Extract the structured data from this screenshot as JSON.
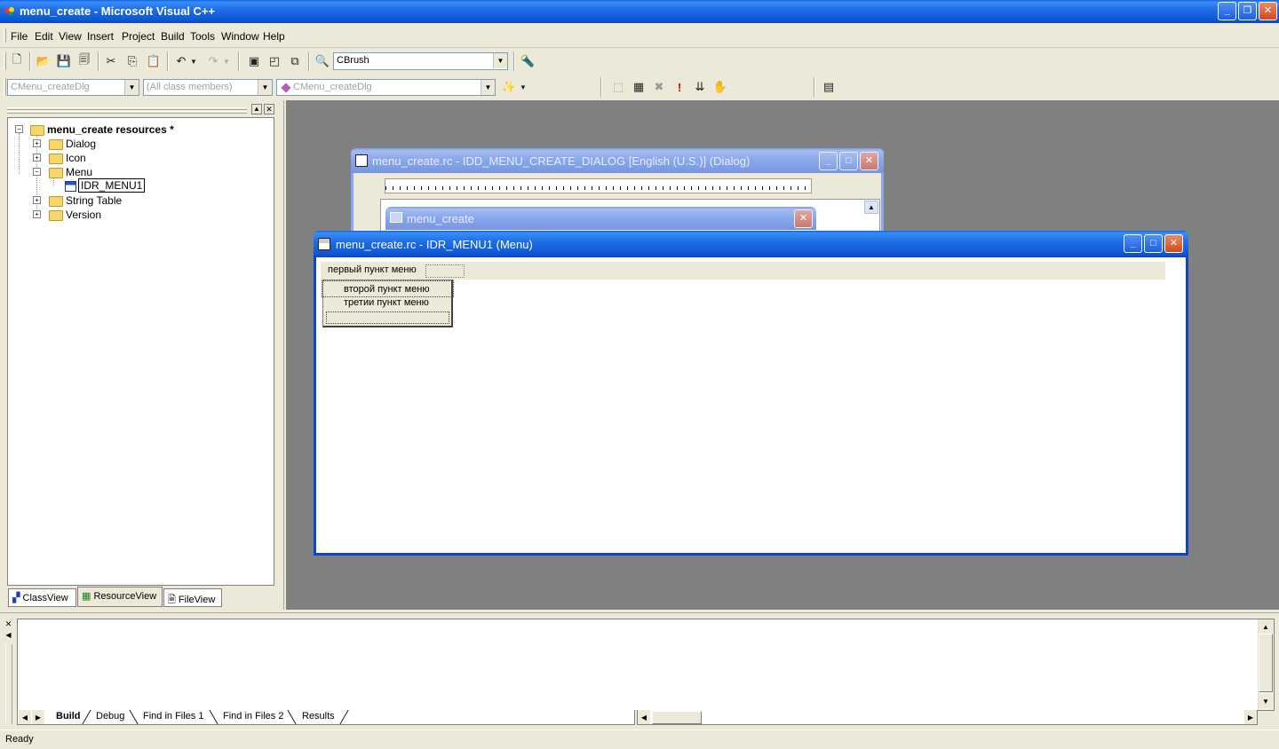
{
  "window": {
    "title": "menu_create - Microsoft Visual C++"
  },
  "menubar": {
    "items": [
      "File",
      "Edit",
      "View",
      "Insert",
      "Project",
      "Build",
      "Tools",
      "Window",
      "Help"
    ]
  },
  "toolbar": {
    "find_combo": "CBrush"
  },
  "wizardbar": {
    "class_combo": "CMenu_createDlg",
    "filter_combo": "(All class members)",
    "members_combo": "CMenu_createDlg"
  },
  "workspace": {
    "root": "menu_create resources *",
    "nodes": [
      "Dialog",
      "Icon",
      "Menu",
      "IDR_MENU1",
      "String Table",
      "Version"
    ],
    "tabs": [
      "ClassView",
      "ResourceView",
      "FileView"
    ]
  },
  "dialog_window": {
    "title": "menu_create.rc - IDD_MENU_CREATE_DIALOG [English (U.S.)] (Dialog)",
    "inner_title": "menu_create"
  },
  "menu_window": {
    "title": "menu_create.rc - IDR_MENU1 (Menu)",
    "top_item": "первый пункт меню",
    "submenu": [
      "второй пункт меню",
      "третии пункт меню"
    ]
  },
  "output": {
    "tabs": [
      "Build",
      "Debug",
      "Find in Files 1",
      "Find in Files 2",
      "Results"
    ]
  },
  "status": {
    "text": "Ready"
  },
  "colors": {
    "accent": "#0a46d0",
    "mdi_background": "#808080"
  }
}
